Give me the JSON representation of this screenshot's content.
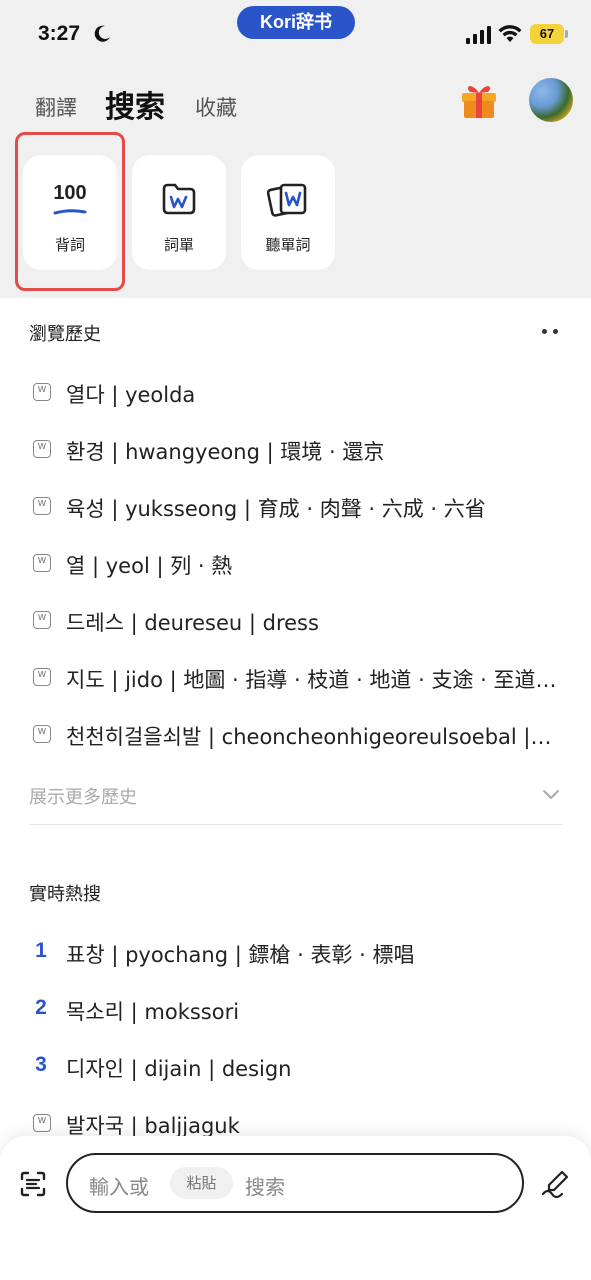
{
  "status_bar": {
    "time": "3:27",
    "app_name": "Kori辞书",
    "battery": "67"
  },
  "tabs": [
    {
      "label": "翻譯",
      "active": false
    },
    {
      "label": "搜索",
      "active": true
    },
    {
      "label": "收藏",
      "active": false
    }
  ],
  "tools": [
    {
      "label": "背詞",
      "icon_text": "100",
      "icon": "recite-100-icon"
    },
    {
      "label": "詞單",
      "icon": "word-folder-icon"
    },
    {
      "label": "聽單詞",
      "icon": "listen-cards-icon"
    }
  ],
  "history": {
    "title": "瀏覽歷史",
    "items": [
      "열다 | yeolda",
      "환경 | hwangyeong | 環境 · 還京",
      "육성 | yuksseong | 育成 · 肉聲 · 六成 · 六省",
      "열 | yeol | 列 · 熱",
      "드레스 | deureseu | dress",
      "지도 | jido | 地圖 · 指導 · 枝道 · 地道 · 支途 · 至道…",
      "천천히걸을쇠발 | cheoncheonhigeoreulsoebal |…"
    ],
    "show_more": "展示更多歷史"
  },
  "hot": {
    "title": "實時熱搜",
    "items": [
      {
        "rank": "1",
        "text": "표창 | pyochang | 鏢槍 · 表彰 · 標唱"
      },
      {
        "rank": "2",
        "text": "목소리 | mokssori"
      },
      {
        "rank": "3",
        "text": "디자인 | dijain | design"
      },
      {
        "rank": "",
        "text": "발자국 | baljjaguk"
      }
    ]
  },
  "search_bar": {
    "placeholder_prefix": "輸入或",
    "paste_label": "粘貼",
    "placeholder_suffix": "搜索"
  },
  "colors": {
    "accent": "#2a55c9",
    "highlight_border": "#e34a4a",
    "top_background": "#f0f0f1"
  }
}
